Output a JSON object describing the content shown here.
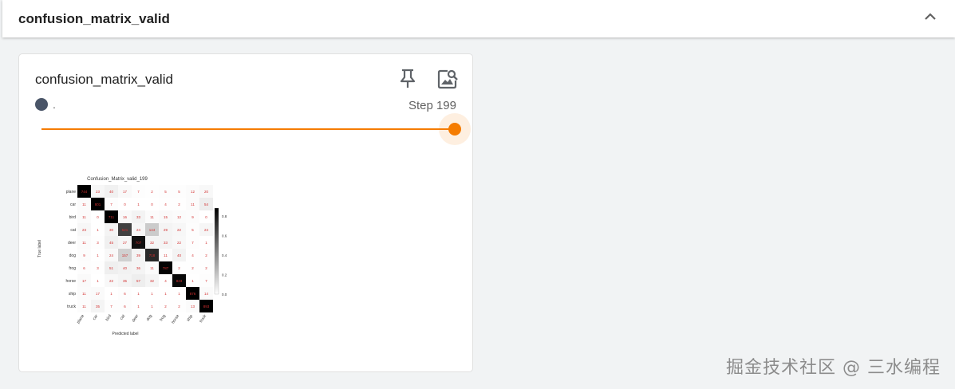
{
  "section": {
    "title": "confusion_matrix_valid"
  },
  "card": {
    "title": "confusion_matrix_valid",
    "run_label": ".",
    "step_label": "Step 199",
    "run_color": "#4a5568",
    "accent_color": "#f57c00",
    "slider_fraction": 1.0
  },
  "icons": {
    "collapse": "chevron-up-icon",
    "pin": "pin-icon",
    "image_search": "image-search-icon"
  },
  "figure": {
    "title": "Confusion_Matrix_valid_199",
    "ylabel": "True label",
    "xlabel": "Predicted label",
    "labels": [
      "plane",
      "car",
      "bird",
      "cat",
      "deer",
      "dog",
      "frog",
      "horse",
      "ship",
      "truck"
    ],
    "colorbar_ticks": [
      "0.8",
      "0.6",
      "0.4",
      "0.2",
      "0.0"
    ],
    "matrix": [
      [
        744,
        23,
        40,
        17,
        7,
        2,
        5,
        5,
        12,
        20
      ],
      [
        11,
        801,
        7,
        0,
        1,
        0,
        4,
        2,
        11,
        54
      ],
      [
        11,
        0,
        711,
        16,
        33,
        11,
        15,
        12,
        9,
        0
      ],
      [
        23,
        1,
        30,
        521,
        24,
        144,
        29,
        22,
        5,
        24
      ],
      [
        11,
        3,
        45,
        27,
        707,
        32,
        33,
        22,
        7,
        1
      ],
      [
        9,
        1,
        24,
        157,
        39,
        718,
        11,
        40,
        4,
        2
      ],
      [
        6,
        3,
        51,
        40,
        36,
        11,
        787,
        2,
        2,
        2
      ],
      [
        17,
        1,
        22,
        35,
        57,
        32,
        4,
        823,
        1,
        7
      ],
      [
        11,
        17,
        1,
        6,
        1,
        1,
        1,
        1,
        876,
        14
      ],
      [
        11,
        35,
        7,
        6,
        1,
        1,
        2,
        2,
        13,
        893
      ]
    ]
  },
  "watermark": "掘金技术社区 @ 三水编程"
}
